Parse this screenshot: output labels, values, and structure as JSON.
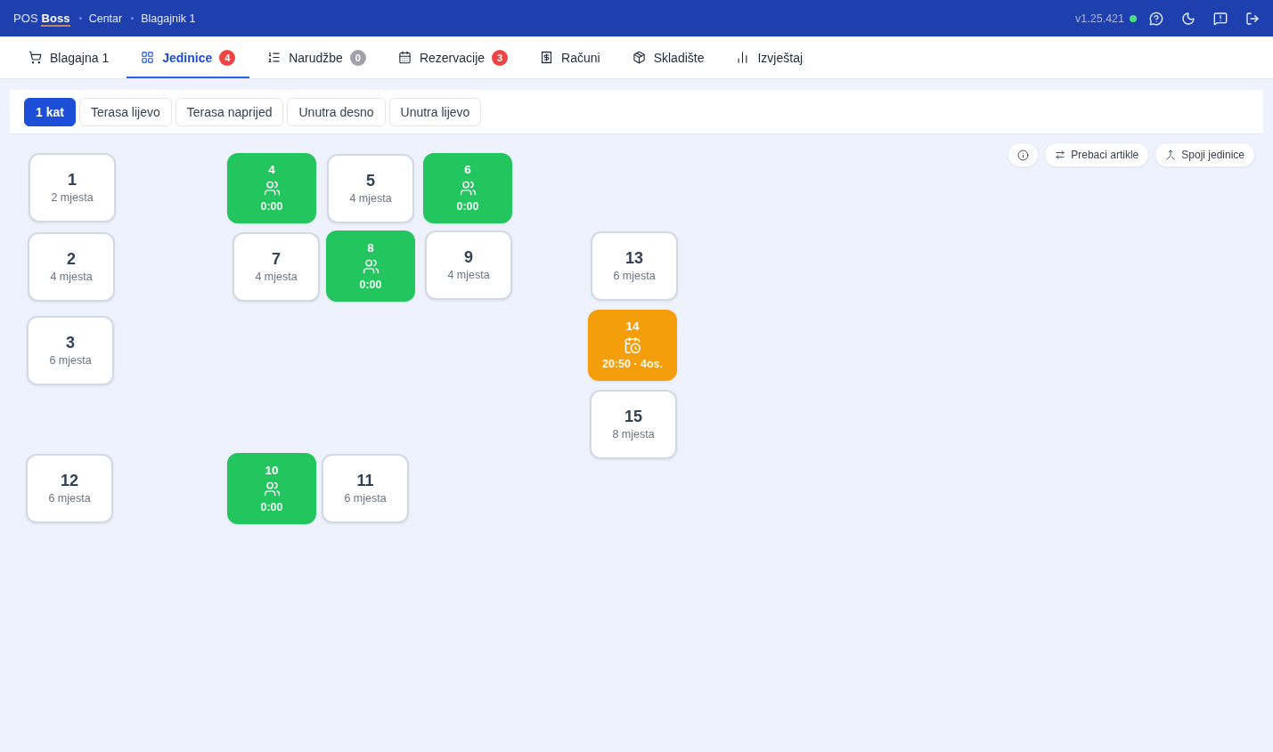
{
  "header": {
    "logo": "POS **Boss**",
    "breadcrumb": [
      "Centar",
      "Blagajnik 1"
    ],
    "version": "v1.25.421",
    "online": true
  },
  "nav_tabs": [
    {
      "label": "Blagajna 1",
      "selected": false
    },
    {
      "label": "Jedinice",
      "selected": true,
      "badge": {
        "text": "4",
        "color": "#ef4444"
      }
    },
    {
      "label": "Narudžbe",
      "selected": false,
      "badge": {
        "text": "0",
        "color": "#a1a1aa"
      }
    },
    {
      "label": "Rezervacije",
      "selected": false,
      "badge": {
        "text": "3",
        "color": "#ef4444"
      }
    },
    {
      "label": "Računi",
      "selected": false
    },
    {
      "label": "Skladište",
      "selected": false
    },
    {
      "label": "Izvještaj",
      "selected": false
    }
  ],
  "floor_tabs": [
    {
      "label": "1 kat",
      "selected": true
    },
    {
      "label": "Terasa lijevo",
      "selected": false
    },
    {
      "label": "Terasa naprijed",
      "selected": false
    },
    {
      "label": "Unutra desno",
      "selected": false
    },
    {
      "label": "Unutra lijevo",
      "selected": false
    }
  ],
  "toolbar": {
    "buttons": [
      "Prebaci artikle",
      "Spoji jedinice"
    ]
  },
  "tables": [
    {
      "number": "1",
      "kind": "free",
      "detail": "2 mjesta"
    },
    {
      "number": "4",
      "kind": "occupied",
      "detail": "0:00"
    },
    {
      "number": "5",
      "kind": "free",
      "detail": "4 mjesta"
    },
    {
      "number": "6",
      "kind": "occupied",
      "detail": "0:00"
    },
    {
      "number": "2",
      "kind": "free",
      "detail": "4 mjesta"
    },
    {
      "number": "7",
      "kind": "free",
      "detail": "4 mjesta"
    },
    {
      "number": "8",
      "kind": "occupied",
      "detail": "0:00"
    },
    {
      "number": "9",
      "kind": "free",
      "detail": "4 mjesta"
    },
    {
      "number": "13",
      "kind": "free",
      "detail": "6 mjesta"
    },
    {
      "number": "3",
      "kind": "free",
      "detail": "6 mjesta"
    },
    {
      "number": "14",
      "kind": "reserved",
      "detail": "20:50 · 4os."
    },
    {
      "number": "15",
      "kind": "free",
      "detail": "8 mjesta"
    },
    {
      "number": "12",
      "kind": "free",
      "detail": "6 mjesta"
    },
    {
      "number": "10",
      "kind": "occupied",
      "detail": "0:00"
    },
    {
      "number": "11",
      "kind": "free",
      "detail": "6 mjesta"
    }
  ]
}
